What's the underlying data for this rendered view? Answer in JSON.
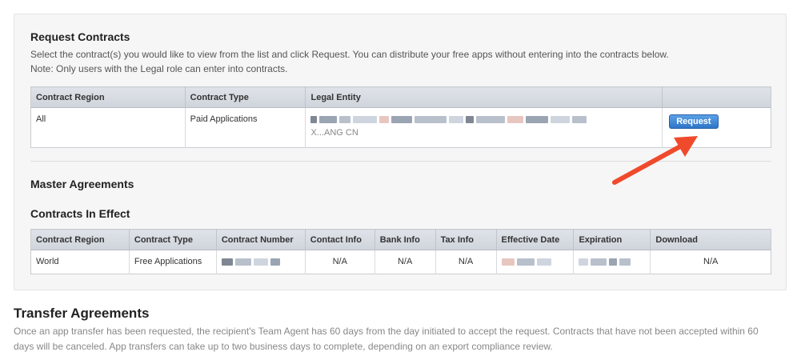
{
  "request_contracts": {
    "title": "Request Contracts",
    "description": "Select the contract(s) you would like to view from the list and click Request. You can distribute your free apps without entering into the contracts below.",
    "note": "Note: Only users with the Legal role can enter into contracts.",
    "columns": [
      "Contract Region",
      "Contract Type",
      "Legal Entity",
      ""
    ],
    "row": {
      "region": "All",
      "type": "Paid Applications",
      "legal_entity_line2": "X...ANG CN",
      "request_label": "Request"
    }
  },
  "master_agreements": {
    "title": "Master Agreements"
  },
  "contracts_in_effect": {
    "title": "Contracts In Effect",
    "columns": [
      "Contract Region",
      "Contract Type",
      "Contract Number",
      "Contact Info",
      "Bank Info",
      "Tax Info",
      "Effective Date",
      "Expiration",
      "Download"
    ],
    "row": {
      "region": "World",
      "type": "Free Applications",
      "contact_info": "N/A",
      "bank_info": "N/A",
      "tax_info": "N/A",
      "download": "N/A"
    }
  },
  "transfer_agreements": {
    "title": "Transfer Agreements",
    "description": "Once an app transfer has been requested, the recipient's Team Agent has 60 days from the day initiated to accept the request. Contracts that have not been accepted within 60 days will be canceled. App transfers can take up to two business days to complete, depending on an export compliance review."
  },
  "colors": {
    "accent": "#2f75c8",
    "annotation_arrow": "#f04a2c"
  },
  "icons": {
    "annotation": "red-arrow-icon"
  }
}
